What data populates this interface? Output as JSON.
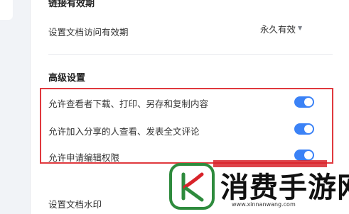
{
  "settings": {
    "link_validity_title": "链接有效期",
    "doc_access_label": "设置文档访问有效期",
    "doc_access_value": "永久有效",
    "advanced_title": "高级设置",
    "allow_download_label": "允许查看者下载、打印、另存和复制内容",
    "allow_download_on": true,
    "allow_comment_label": "允许加入分享的人查看、发表全文评论",
    "allow_comment_on": true,
    "allow_edit_request_label": "允许申请编辑权限",
    "allow_edit_request_on": true,
    "watermark_label": "设置文档水印"
  },
  "watermark_overlay": {
    "title": "消费手游网",
    "url": "www.xinnanwang.com"
  },
  "colors": {
    "toggle_on": "#3b82f6",
    "highlight_border": "#e0393e",
    "logo_green": "#2e8b3d",
    "logo_red": "#d8232a"
  }
}
